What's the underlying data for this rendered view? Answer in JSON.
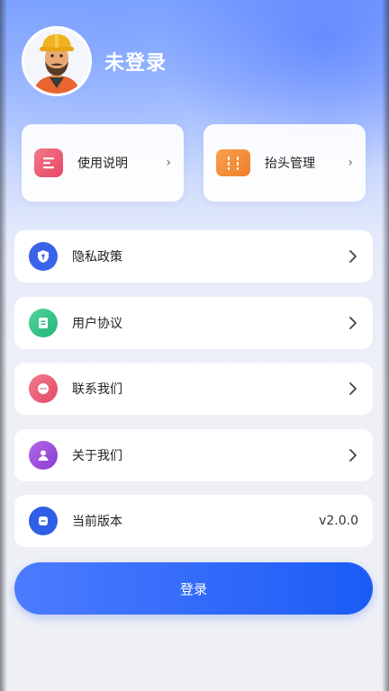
{
  "profile": {
    "username": "未登录",
    "avatar_icon": "worker-avatar-icon"
  },
  "quick_actions": [
    {
      "label": "使用说明",
      "icon": "document-list-icon",
      "color": "#ef5a74",
      "arrow": "›"
    },
    {
      "label": "抬头管理",
      "icon": "ticket-icon",
      "color": "#f5913a",
      "arrow": "›"
    }
  ],
  "menu": [
    {
      "label": "隐私政策",
      "icon": "shield-lock-icon",
      "color": "#3a63ea"
    },
    {
      "label": "用户协议",
      "icon": "agreement-icon",
      "color": "#34c48a"
    },
    {
      "label": "联系我们",
      "icon": "chat-bubble-icon",
      "color": "#ec5b72"
    },
    {
      "label": "关于我们",
      "icon": "user-icon",
      "color": "#9a4ddb"
    }
  ],
  "version": {
    "label": "当前版本",
    "icon": "version-icon",
    "color": "#2f5fe6",
    "value": "v2.0.0"
  },
  "login_button": "登录"
}
